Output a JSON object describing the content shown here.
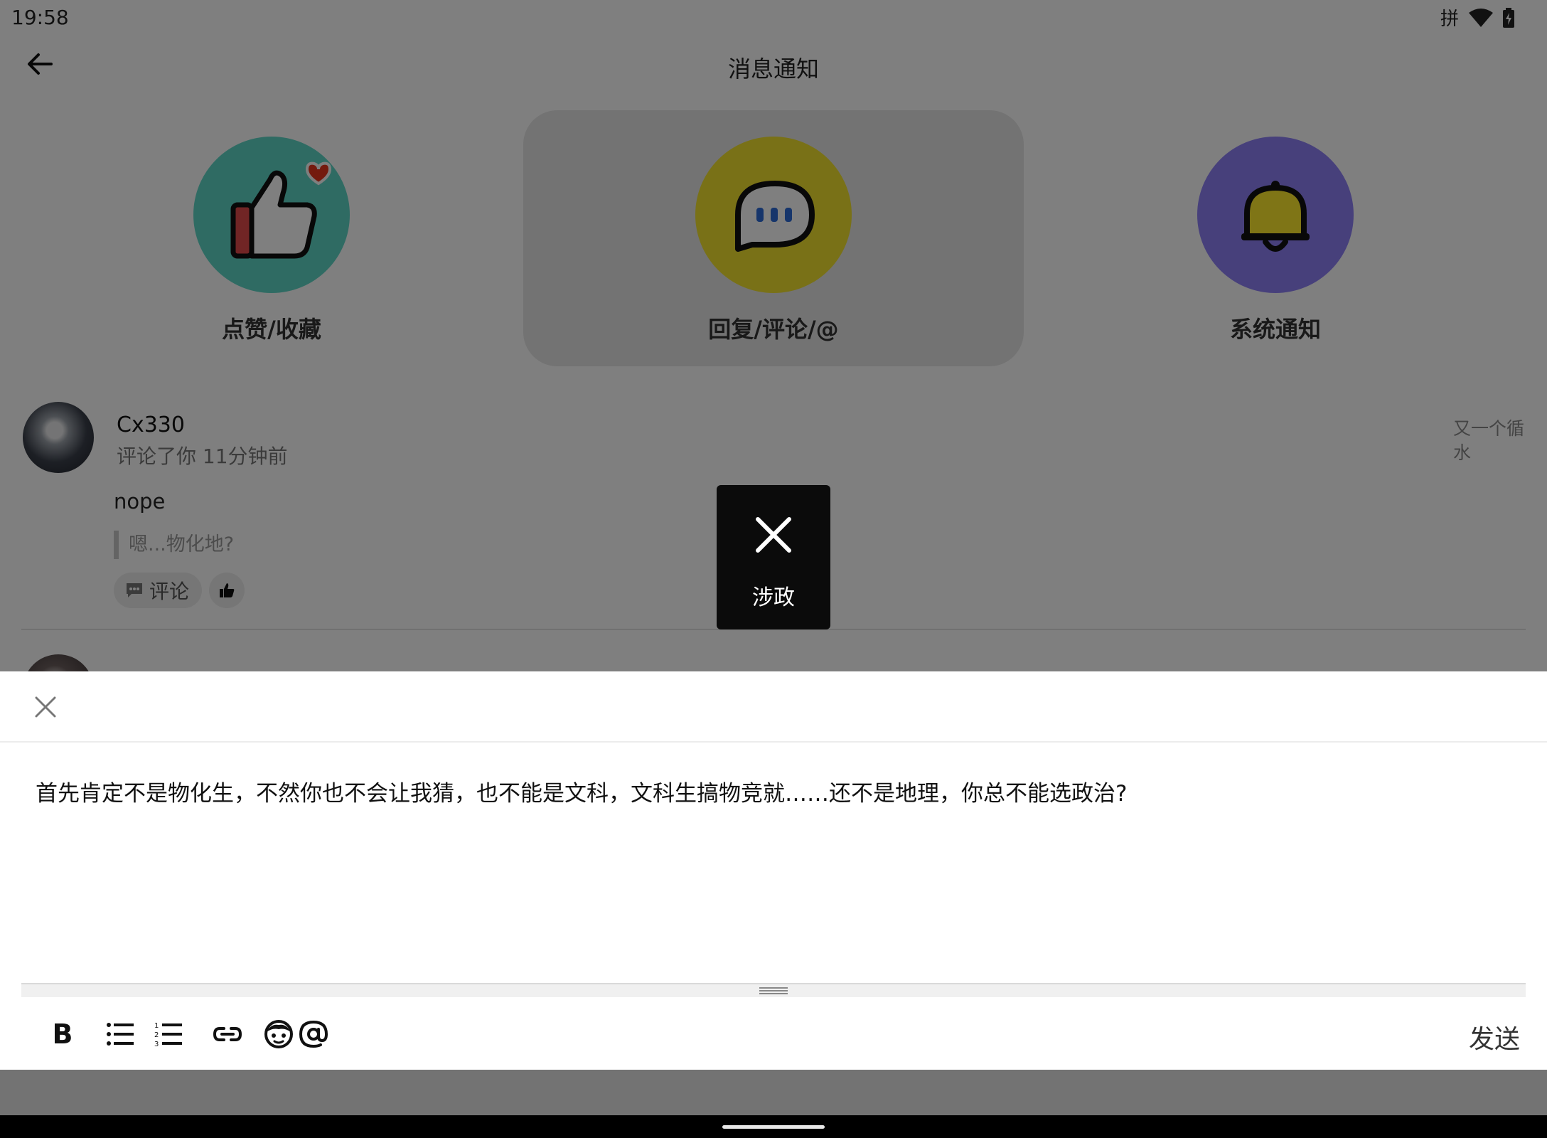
{
  "status_bar": {
    "time": "19:58",
    "ime": "拼"
  },
  "app_bar": {
    "title": "消息通知"
  },
  "categories": [
    {
      "label": "点赞/收藏",
      "icon": "thumbs-up-heart-icon",
      "color": "#5fd6c6"
    },
    {
      "label": "回复/评论/@",
      "icon": "chat-bubble-icon",
      "color": "#f2e22e"
    },
    {
      "label": "系统通知",
      "icon": "bell-icon",
      "color": "#8f80f7"
    }
  ],
  "message": {
    "username": "Cx330",
    "action": "评论了你 11分钟前",
    "post_title": "又一个循水",
    "body": "nope",
    "quote": "嗯...物化地?",
    "reply_label": "评论"
  },
  "toast": {
    "text": "涉政"
  },
  "editor": {
    "content": "首先肯定不是物化生，不然你也不会让我猜，也不能是文科，文科生搞物竞就……还不是地理，你总不能选政治?"
  },
  "toolbar": {
    "bold_label": "B",
    "send_label": "发送"
  }
}
